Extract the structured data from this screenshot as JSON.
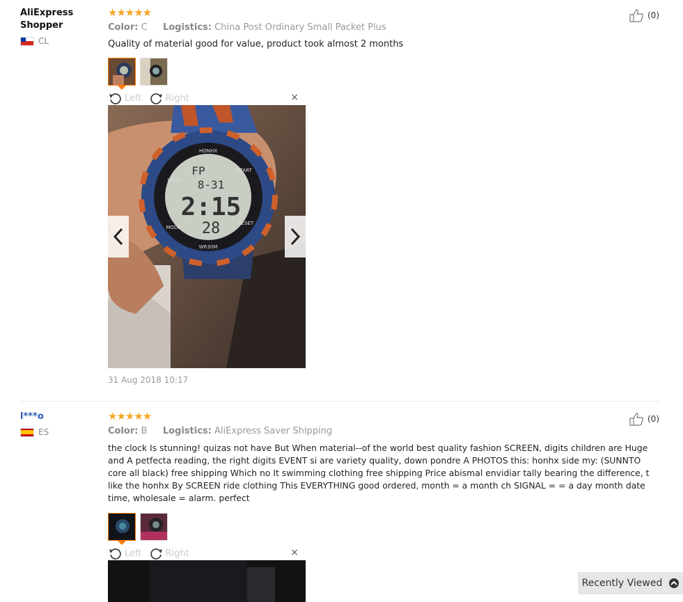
{
  "reviews": [
    {
      "user": "AliExpress Shopper",
      "country": "CL",
      "stars": "★★★★★",
      "color_label": "Color:",
      "color_value": "C",
      "logistics_label": "Logistics:",
      "logistics_value": "China Post Ordinary Small Packet Plus",
      "text": "Quality of material good for value, product took almost 2 months",
      "rotate_left": "Left",
      "rotate_right": "Right",
      "close": "×",
      "date": "31 Aug 2018 10:17",
      "likes": "(0)"
    },
    {
      "user": "l***o",
      "country": "ES",
      "stars": "★★★★★",
      "color_label": "Color:",
      "color_value": "B",
      "logistics_label": "Logistics:",
      "logistics_value": "AliExpress Saver Shipping",
      "text": "the clock Is stunning! quizas not have But When material--of the world best quality fashion SCREEN, digits children are Huge and A petfecta reading, the right digits EVENT si are variety quality, down pondre A PHOTOS this: honhx side my: (SUNNTO core all black) free shipping Which no It swimming clothing free shipping Price abismal envidiar tally bearing the difference, t like the honhx By SCREEN ride clothing This EVERYTHING good ordered, month = a month ch SIGNAL = = a day month date time, wholesale = alarm. perfect",
      "rotate_left": "Left",
      "rotate_right": "Right",
      "close": "×",
      "likes": "(0)"
    }
  ],
  "watch_display": {
    "top": "FP",
    "date": "8-31",
    "time": "2:15",
    "seconds": "28",
    "brand": "HONHX",
    "wr": "WR30M",
    "light": "LIGHT",
    "start": "START",
    "mode": "MODE",
    "reset": "RESET"
  },
  "recently_viewed": "Recently Viewed"
}
